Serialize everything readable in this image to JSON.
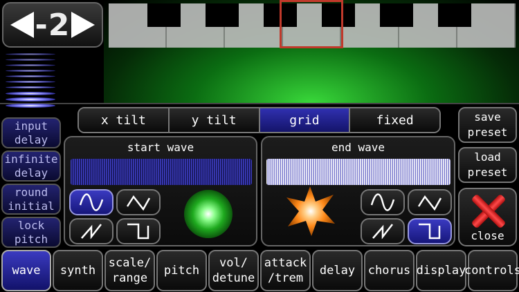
{
  "octave": {
    "value": "-2"
  },
  "keyboard": {
    "selected_key_index": 3
  },
  "mode_tabs": [
    {
      "label": "x tilt",
      "active": false
    },
    {
      "label": "y tilt",
      "active": false
    },
    {
      "label": "grid",
      "active": true
    },
    {
      "label": "fixed",
      "active": false
    }
  ],
  "left_buttons": [
    {
      "line1": "input",
      "line2": "delay"
    },
    {
      "line1": "infinite",
      "line2": "delay"
    },
    {
      "line1": "round",
      "line2": "initial"
    },
    {
      "line1": "lock",
      "line2": "pitch"
    }
  ],
  "start_wave": {
    "title": "start wave",
    "selected": "sine"
  },
  "end_wave": {
    "title": "end wave",
    "selected": "square"
  },
  "right_buttons": {
    "save": {
      "line1": "save",
      "line2": "preset"
    },
    "load": {
      "line1": "load",
      "line2": "preset"
    },
    "close": "close"
  },
  "bottom_tabs": [
    {
      "line1": "wave",
      "line2": "",
      "active": true
    },
    {
      "line1": "synth",
      "line2": "",
      "active": false
    },
    {
      "line1": "scale/",
      "line2": "range",
      "active": false
    },
    {
      "line1": "pitch",
      "line2": "",
      "active": false
    },
    {
      "line1": "vol/",
      "line2": "detune",
      "active": false
    },
    {
      "line1": "attack",
      "line2": "/trem",
      "active": false
    },
    {
      "line1": "delay",
      "line2": "",
      "active": false
    },
    {
      "line1": "chorus",
      "line2": "",
      "active": false
    },
    {
      "line1": "display",
      "line2": "",
      "active": false
    },
    {
      "line1": "controls",
      "line2": "",
      "active": false
    }
  ],
  "colors": {
    "accent_blue": "#2a2aa0",
    "glow_green": "#39d93a",
    "close_red": "#e02020",
    "star_orange": "#ff8a1a"
  }
}
